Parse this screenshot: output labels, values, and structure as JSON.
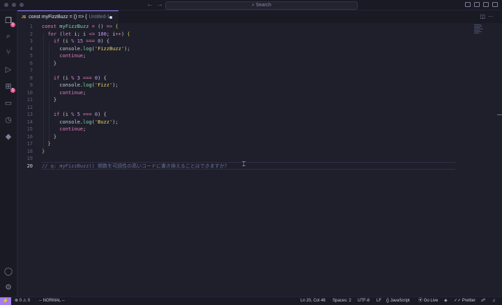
{
  "window": {
    "search_placeholder": "Search"
  },
  "activity": {
    "explorer_badge": "1",
    "extensions_badge": "1"
  },
  "tab": {
    "lang": "JS",
    "title": "const myFizzBuzz = () => {",
    "subtitle": "Untitled-1"
  },
  "editor": {
    "current_line": 20,
    "lines": [
      {
        "n": "1",
        "html": "<span class=\"kw\">const</span> <span class=\"fn\">myFizzBuzz</span> <span class=\"op\">=</span> <span class=\"pn\">() </span><span class=\"op\">=&gt;</span> <span class=\"cb\">{</span>"
      },
      {
        "n": "2",
        "html": "  <span class=\"kw\">for</span> <span class=\"pn\">(</span><span class=\"kw\">let</span> <span class=\"pn\">i; i </span><span class=\"op\">&lt;=</span> <span class=\"num\">100</span><span class=\"pn\">; i</span><span class=\"op\">++</span><span class=\"pn\">) </span><span class=\"cb\">{</span>"
      },
      {
        "n": "3",
        "html": "    <span class=\"kw\">if</span> <span class=\"pn\">(i </span><span class=\"op\">%</span> <span class=\"num\">15</span> <span class=\"op\">===</span> <span class=\"num\">0</span><span class=\"pn\">) {</span>"
      },
      {
        "n": "4",
        "html": "      <span class=\"pn\">console.</span><span class=\"fn\">log</span><span class=\"pn\">(</span><span class=\"str\">'FizzBuzz'</span><span class=\"pn\">);</span>"
      },
      {
        "n": "5",
        "html": "      <span class=\"kw\">continue</span><span class=\"pn\">;</span>"
      },
      {
        "n": "6",
        "html": "    <span class=\"pn\">}</span>"
      },
      {
        "n": "7",
        "html": ""
      },
      {
        "n": "8",
        "html": "    <span class=\"kw\">if</span> <span class=\"pn\">(i </span><span class=\"op\">%</span> <span class=\"num\">3</span> <span class=\"op\">===</span> <span class=\"num\">0</span><span class=\"pn\">) {</span>"
      },
      {
        "n": "9",
        "html": "      <span class=\"pn\">console.</span><span class=\"fn\">log</span><span class=\"pn\">(</span><span class=\"str\">'Fizz'</span><span class=\"pn\">);</span>"
      },
      {
        "n": "10",
        "html": "      <span class=\"kw\">continue</span><span class=\"pn\">;</span>"
      },
      {
        "n": "11",
        "html": "    <span class=\"pn\">}</span>"
      },
      {
        "n": "12",
        "html": ""
      },
      {
        "n": "13",
        "html": "    <span class=\"kw\">if</span> <span class=\"pn\">(i </span><span class=\"op\">%</span> <span class=\"num\">5</span> <span class=\"op\">===</span> <span class=\"num\">0</span><span class=\"pn\">) {</span>"
      },
      {
        "n": "14",
        "html": "      <span class=\"pn\">console.</span><span class=\"fn\">log</span><span class=\"pn\">(</span><span class=\"str\">'Buzz'</span><span class=\"pn\">);</span>"
      },
      {
        "n": "15",
        "html": "      <span class=\"kw\">continue</span><span class=\"pn\">;</span>"
      },
      {
        "n": "16",
        "html": "    <span class=\"pn\">}</span>"
      },
      {
        "n": "17",
        "html": "  <span class=\"cb\">}</span>"
      },
      {
        "n": "18",
        "html": "<span class=\"cb\">}</span>"
      },
      {
        "n": "19",
        "html": ""
      },
      {
        "n": "20",
        "html": "<span class=\"cm\">// q: myFizzBuzz() 関数を可読性の高いコードに書き換えることはできますか？</span>"
      }
    ]
  },
  "status": {
    "problems": "0",
    "warnings": "0",
    "mode": "-- NORMAL --",
    "position": "Ln 20, Col 46",
    "spaces": "Spaces: 2",
    "encoding": "UTF-8",
    "eol": "LF",
    "language": "JavaScript",
    "golive": "Go Live",
    "prettier": "Prettier"
  }
}
